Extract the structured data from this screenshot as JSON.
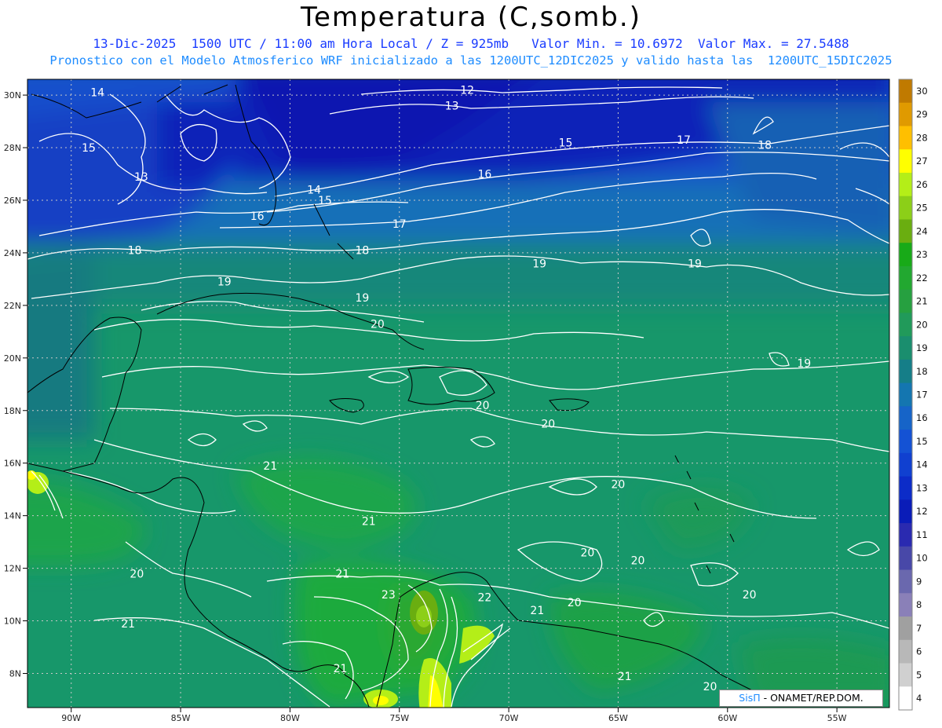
{
  "title": "Temperatura (C,somb.)",
  "subtitle_1": "13-Dic-2025  1500 UTC / 11:00 am Hora Local / Z = 925mb   Valor Min. = 10.6972  Valor Max. = 27.5488",
  "subtitle_2": "Pronostico con el Modelo Atmosferico WRF inicializado a las 1200UTC_12DIC2025 y valido hasta las  1200UTC_15DIC2025",
  "credit": {
    "brand": "SisΠ",
    "text": "- ONAMET/REP.DOM."
  },
  "map": {
    "lon_range": [
      -92,
      -52.6
    ],
    "lat_range": [
      6.7,
      30.6
    ],
    "lon_ticks": [
      {
        "value": -90,
        "label": "90W"
      },
      {
        "value": -85,
        "label": "85W"
      },
      {
        "value": -80,
        "label": "80W"
      },
      {
        "value": -75,
        "label": "75W"
      },
      {
        "value": -70,
        "label": "70W"
      },
      {
        "value": -65,
        "label": "65W"
      },
      {
        "value": -60,
        "label": "60W"
      },
      {
        "value": -55,
        "label": "55W"
      }
    ],
    "lat_ticks": [
      {
        "value": 30,
        "label": "30N"
      },
      {
        "value": 28,
        "label": "28N"
      },
      {
        "value": 26,
        "label": "26N"
      },
      {
        "value": 24,
        "label": "24N"
      },
      {
        "value": 22,
        "label": "22N"
      },
      {
        "value": 20,
        "label": "20N"
      },
      {
        "value": 18,
        "label": "18N"
      },
      {
        "value": 16,
        "label": "16N"
      },
      {
        "value": 14,
        "label": "14N"
      },
      {
        "value": 12,
        "label": "12N"
      },
      {
        "value": 10,
        "label": "10N"
      },
      {
        "value": 8,
        "label": "8N"
      }
    ],
    "contour_labels": [
      {
        "text": "14",
        "lon": -88.8,
        "lat": 30.1
      },
      {
        "text": "12",
        "lon": -71.9,
        "lat": 30.2
      },
      {
        "text": "13",
        "lon": -72.6,
        "lat": 29.6
      },
      {
        "text": "15",
        "lon": -89.2,
        "lat": 28.0
      },
      {
        "text": "15",
        "lon": -67.4,
        "lat": 28.2
      },
      {
        "text": "17",
        "lon": -62.0,
        "lat": 28.3
      },
      {
        "text": "18",
        "lon": -58.3,
        "lat": 28.1
      },
      {
        "text": "13",
        "lon": -86.8,
        "lat": 26.9
      },
      {
        "text": "16",
        "lon": -71.1,
        "lat": 27.0
      },
      {
        "text": "14",
        "lon": -78.9,
        "lat": 26.4
      },
      {
        "text": "15",
        "lon": -78.4,
        "lat": 26.0
      },
      {
        "text": "16",
        "lon": -81.5,
        "lat": 25.4
      },
      {
        "text": "17",
        "lon": -75.0,
        "lat": 25.1
      },
      {
        "text": "18",
        "lon": -87.1,
        "lat": 24.1
      },
      {
        "text": "18",
        "lon": -76.7,
        "lat": 24.1
      },
      {
        "text": "19",
        "lon": -68.6,
        "lat": 23.6
      },
      {
        "text": "19",
        "lon": -61.5,
        "lat": 23.6
      },
      {
        "text": "19",
        "lon": -83.0,
        "lat": 22.9
      },
      {
        "text": "19",
        "lon": -76.7,
        "lat": 22.3
      },
      {
        "text": "20",
        "lon": -76.0,
        "lat": 21.3
      },
      {
        "text": "19",
        "lon": -56.5,
        "lat": 19.8
      },
      {
        "text": "20",
        "lon": -71.2,
        "lat": 18.2
      },
      {
        "text": "20",
        "lon": -68.2,
        "lat": 17.5
      },
      {
        "text": "21",
        "lon": -80.9,
        "lat": 15.9
      },
      {
        "text": "20",
        "lon": -65.0,
        "lat": 15.2
      },
      {
        "text": "21",
        "lon": -76.4,
        "lat": 13.8
      },
      {
        "text": "20",
        "lon": -66.4,
        "lat": 12.6
      },
      {
        "text": "20",
        "lon": -64.1,
        "lat": 12.3
      },
      {
        "text": "21",
        "lon": -77.6,
        "lat": 11.8
      },
      {
        "text": "20",
        "lon": -87.0,
        "lat": 11.8
      },
      {
        "text": "23",
        "lon": -75.5,
        "lat": 11.0
      },
      {
        "text": "22",
        "lon": -71.1,
        "lat": 10.9
      },
      {
        "text": "20",
        "lon": -59.0,
        "lat": 11.0
      },
      {
        "text": "21",
        "lon": -68.7,
        "lat": 10.4
      },
      {
        "text": "20",
        "lon": -67.0,
        "lat": 10.7
      },
      {
        "text": "21",
        "lon": -87.4,
        "lat": 9.9
      },
      {
        "text": "21",
        "lon": -77.7,
        "lat": 8.2
      },
      {
        "text": "21",
        "lon": -64.7,
        "lat": 7.9
      },
      {
        "text": "20",
        "lon": -60.8,
        "lat": 7.5
      }
    ]
  },
  "colorbar": {
    "levels": [
      30,
      29,
      28,
      27,
      26,
      25,
      24,
      23,
      22,
      21,
      20,
      19,
      18,
      17,
      16,
      15,
      14,
      13,
      12,
      11,
      10,
      9,
      8,
      7,
      6,
      5,
      4
    ],
    "colors": [
      "#c07a00",
      "#e09a00",
      "#ffbf00",
      "#ffff00",
      "#b4ee18",
      "#8ccf18",
      "#6aae10",
      "#18aa18",
      "#22a830",
      "#26a040",
      "#219a5a",
      "#1a8e6e",
      "#157e88",
      "#1476b0",
      "#1664c8",
      "#1452d4",
      "#1040d0",
      "#0c2cc8",
      "#0a1cb8",
      "#2a2ab0",
      "#4848a8",
      "#6a68ae",
      "#8a80b8",
      "#a0a0a0",
      "#b8b8b8",
      "#d0d0d0",
      "#ffffff"
    ]
  }
}
